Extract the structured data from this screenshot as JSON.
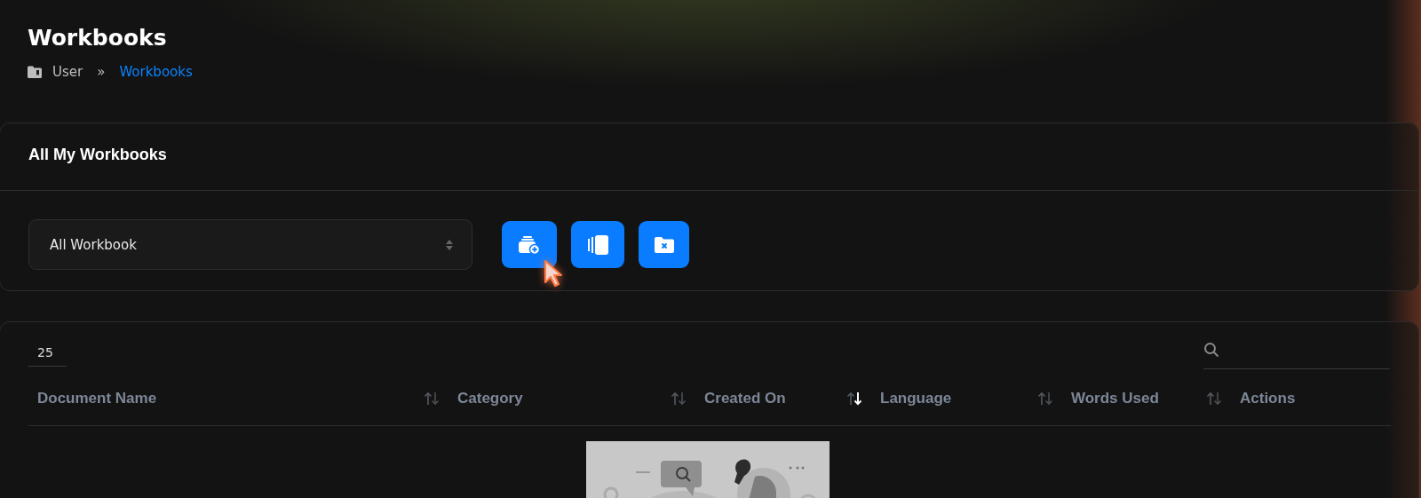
{
  "page": {
    "title": "Workbooks"
  },
  "breadcrumb": [
    {
      "label": "User",
      "current": false
    },
    {
      "label": "»",
      "kind": "separator"
    },
    {
      "label": "Workbooks",
      "current": true
    }
  ],
  "workbooks_card": {
    "title": "All My Workbooks",
    "filter": {
      "value": "All Workbook"
    },
    "buttons": [
      {
        "kind": "add",
        "hovered": true
      },
      {
        "kind": "pages",
        "hovered": false
      },
      {
        "kind": "delete",
        "hovered": false
      }
    ]
  },
  "table": {
    "page_size": "25",
    "columns": [
      {
        "label": "Document Name",
        "sortable": true,
        "sorted_desc": false
      },
      {
        "label": "Category",
        "sortable": true,
        "sorted_desc": false
      },
      {
        "label": "Created On",
        "sortable": true,
        "sorted_desc": true
      },
      {
        "label": "Language",
        "sortable": true,
        "sorted_desc": false
      },
      {
        "label": "Words Used",
        "sortable": true,
        "sorted_desc": false
      },
      {
        "label": "Actions"
      }
    ]
  }
}
